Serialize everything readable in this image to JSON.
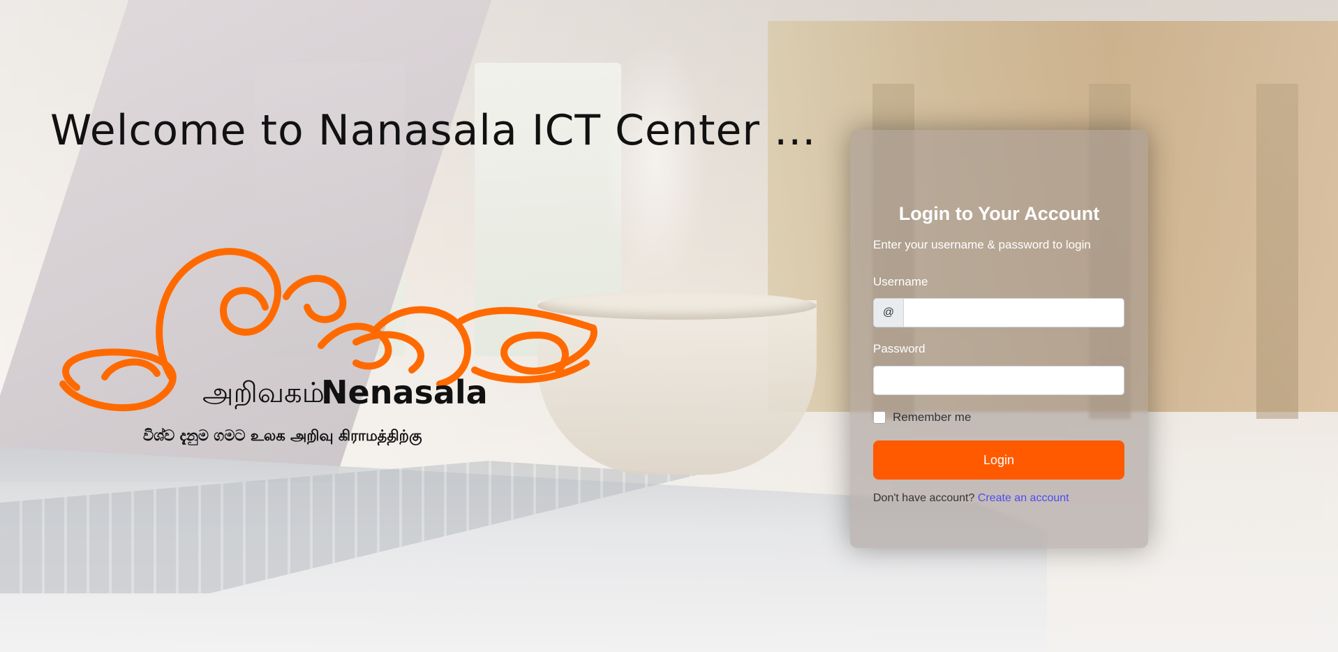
{
  "welcome": {
    "heading": "Welcome to Nanasala ICT Center ..."
  },
  "logo": {
    "tamil_name": "அறிவகம் -",
    "brand_name": "Nenasala",
    "tagline": "විශ්ව දැනුම ගමට  உலக அறிவு கிராமத்திற்கு",
    "accent_color": "#ff6a00"
  },
  "login": {
    "title": "Login to Your Account",
    "subtitle": "Enter your username & password to login",
    "username_label": "Username",
    "username_addon": "@",
    "username_value": "",
    "password_label": "Password",
    "password_value": "",
    "remember_label": "Remember me",
    "button_label": "Login",
    "signup_prompt": "Don't have account?",
    "signup_link": "Create an account",
    "button_color": "#ff5a00",
    "link_color": "#4a4df0"
  }
}
